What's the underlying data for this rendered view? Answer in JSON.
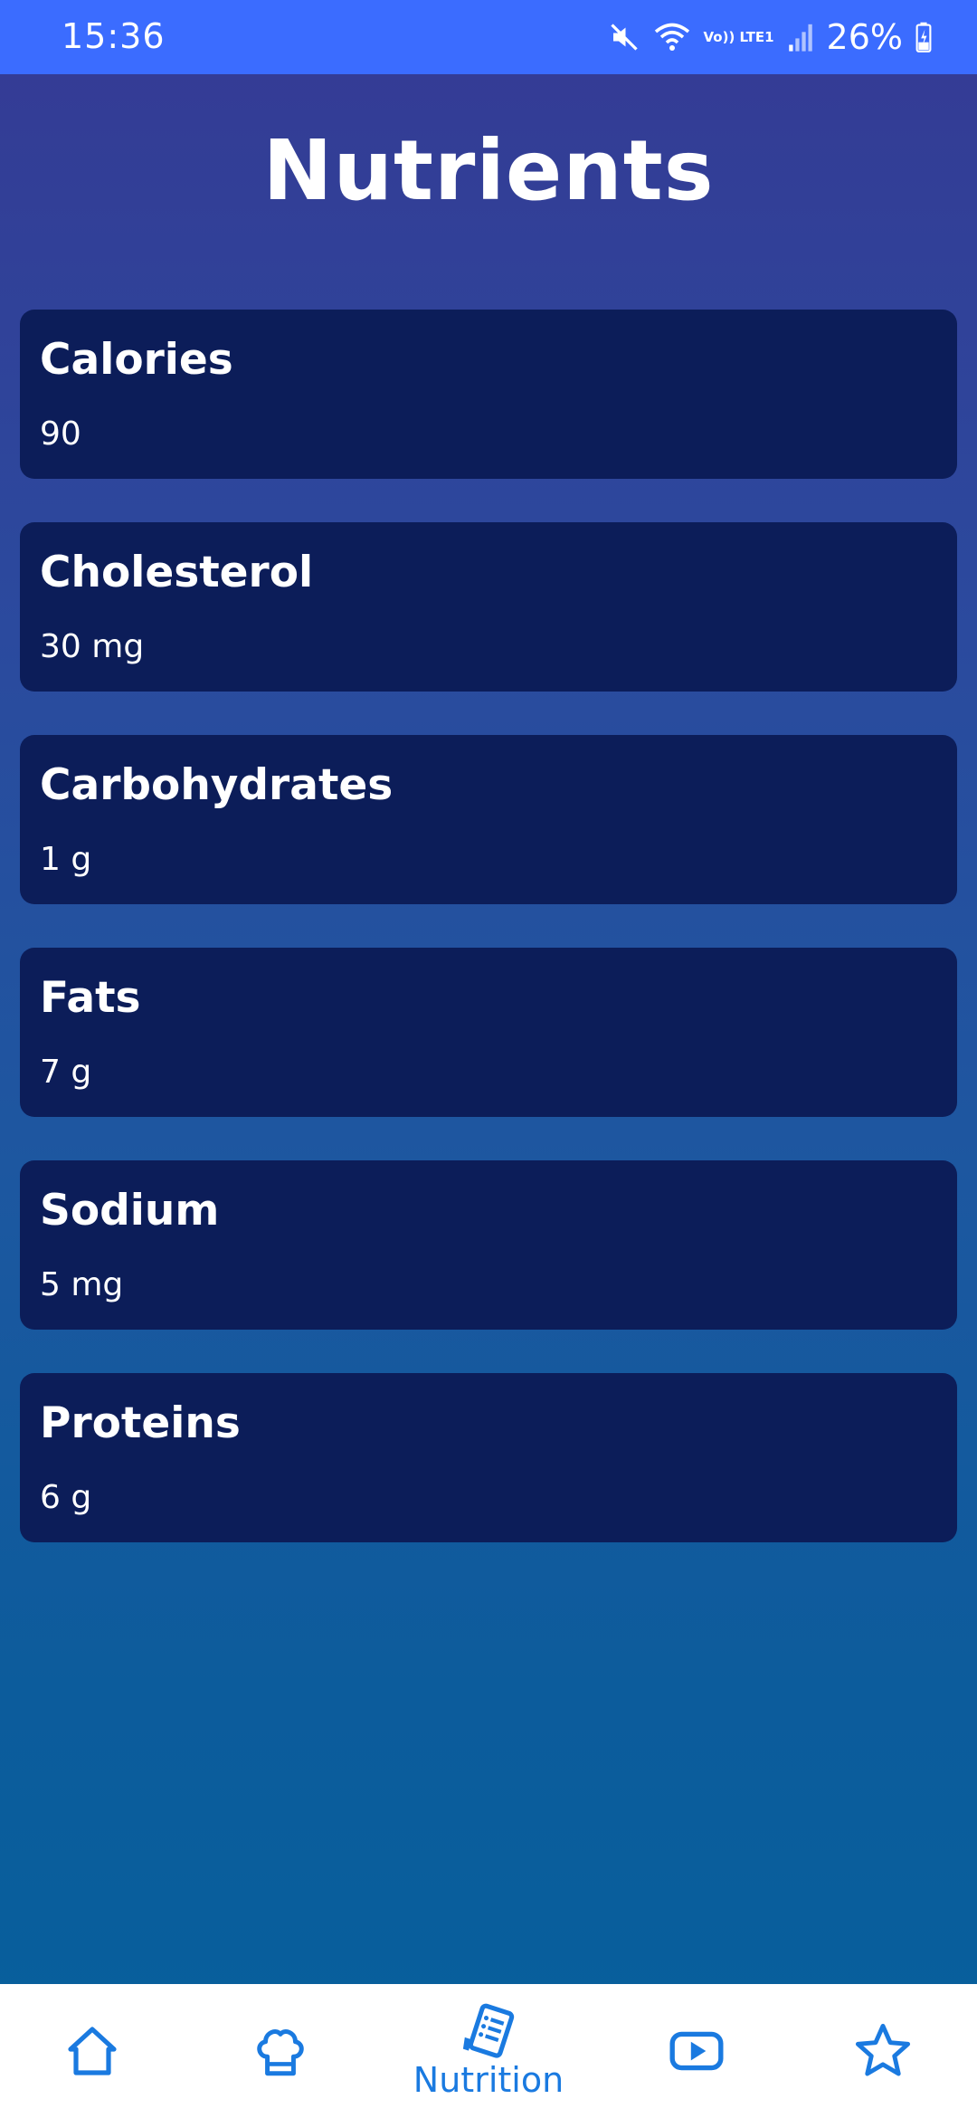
{
  "status_bar": {
    "time": "15:36",
    "network": "Vo)) LTE1",
    "battery": "26%"
  },
  "page_title": "Nutrients",
  "nutrients": [
    {
      "label": "Calories",
      "value": "90"
    },
    {
      "label": "Cholesterol",
      "value": "30 mg"
    },
    {
      "label": "Carbohydrates",
      "value": "1 g"
    },
    {
      "label": "Fats",
      "value": "7 g"
    },
    {
      "label": "Sodium",
      "value": "5 mg"
    },
    {
      "label": "Proteins",
      "value": "6 g"
    }
  ],
  "bottom_nav": {
    "items": [
      {
        "icon": "home-icon",
        "label": ""
      },
      {
        "icon": "chef-hat-icon",
        "label": ""
      },
      {
        "icon": "nutrition-list-icon",
        "label": "Nutrition"
      },
      {
        "icon": "video-play-icon",
        "label": ""
      },
      {
        "icon": "star-icon",
        "label": ""
      }
    ]
  },
  "colors": {
    "status_bar": "#3b6cff",
    "card_background": "#0c1d59",
    "nav_accent": "#1a7ae0",
    "nav_background": "#ffffff"
  }
}
